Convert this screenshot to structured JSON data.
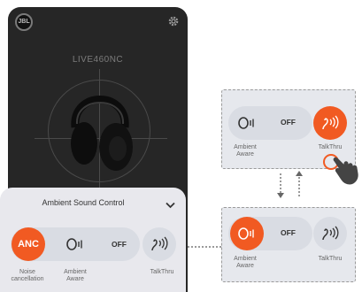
{
  "phone": {
    "logo_text": "JBL",
    "model_name": "LIVE460NC",
    "gear_icon": "gear-icon",
    "headphone_icon": "headphones-icon"
  },
  "sheet": {
    "title": "Ambient Sound Control",
    "chevron_icon": "chevron-down-icon",
    "anc_label": "ANC",
    "noise_cancellation_label": "Noise\ncancellation",
    "ambient_aware_label": "Ambient\nAware",
    "off_label": "OFF",
    "talkthru_label": "TalkThru"
  },
  "panel_top": {
    "ambient_aware_label": "Ambient\nAware",
    "off_label": "OFF",
    "talkthru_label": "TalkThru",
    "active_mode": "TalkThru",
    "hand_icon": "pointing-hand-icon"
  },
  "panel_bottom": {
    "ambient_aware_label": "Ambient\nAware",
    "off_label": "OFF",
    "talkthru_label": "TalkThru",
    "active_mode": "Ambient Aware"
  },
  "colors": {
    "accent": "#f15a22",
    "phone_bg": "#262626",
    "sheet_bg": "#e8e8ed",
    "pill_bg": "#d9dce3"
  }
}
